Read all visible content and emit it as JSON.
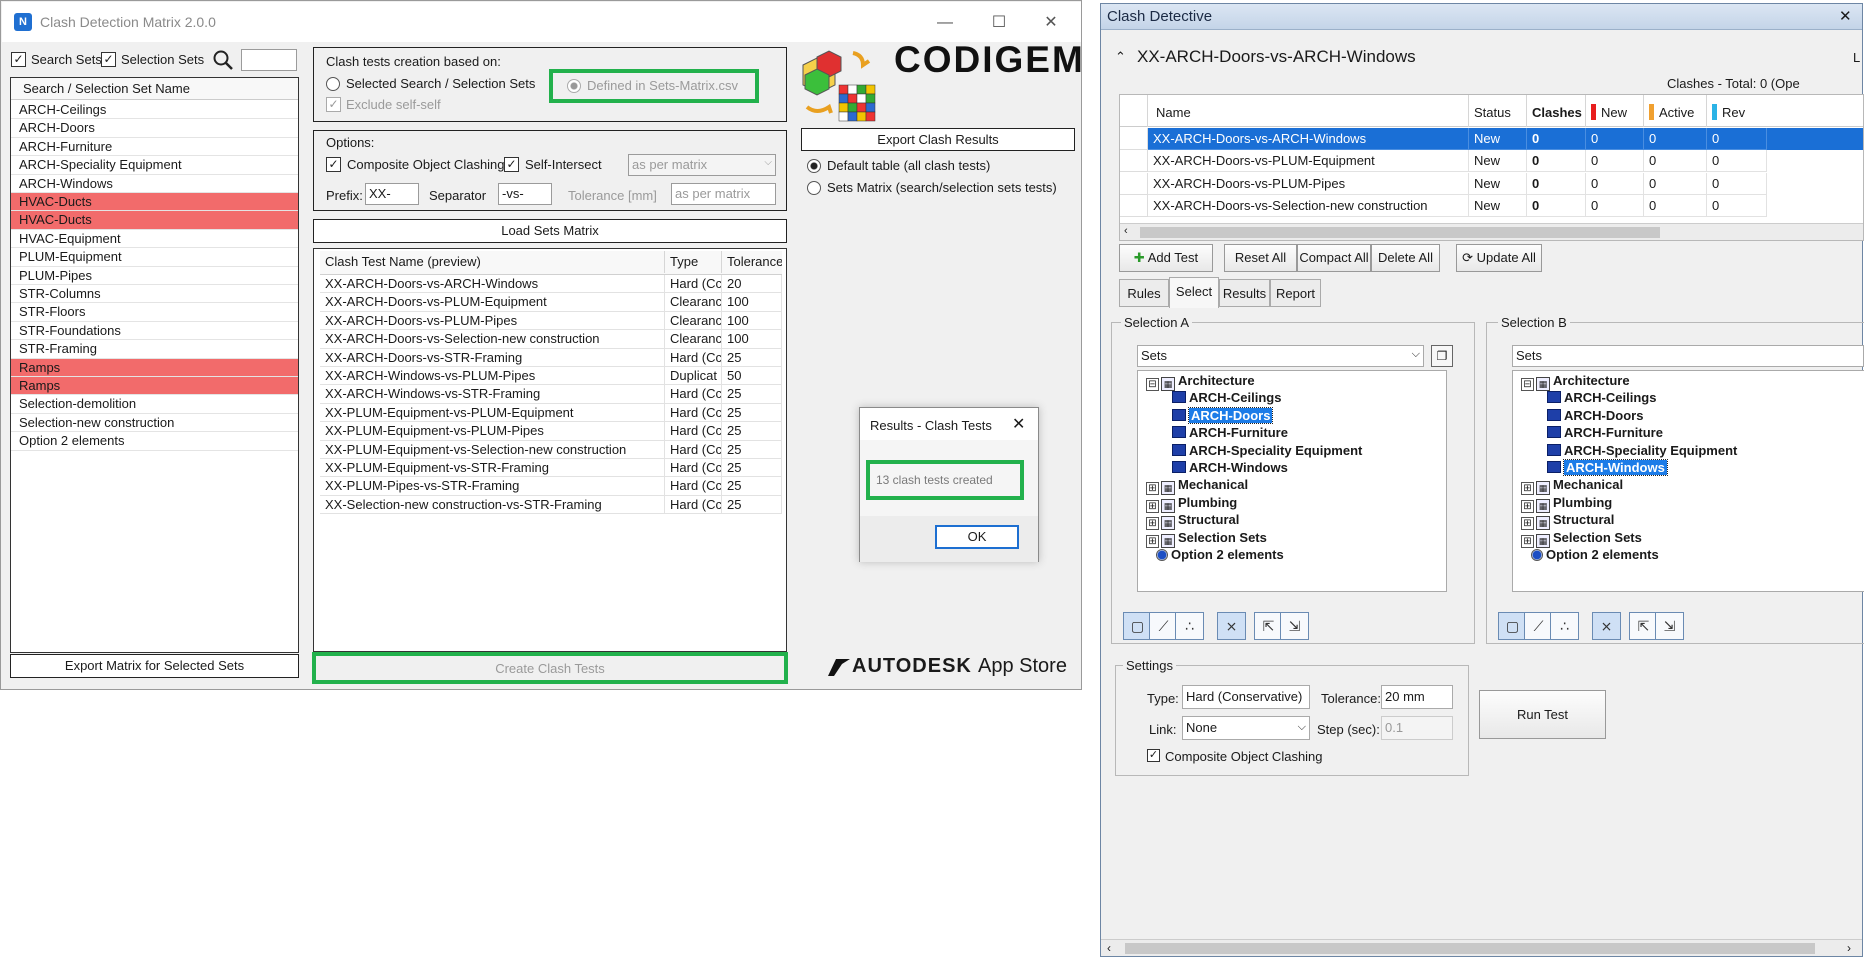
{
  "left_window": {
    "app_icon": "N",
    "title": "Clash Detection Matrix 2.0.0",
    "controls": {
      "minimize": "—",
      "maximize": "☐",
      "close": "✕"
    },
    "filters": {
      "search_sets": "Search Sets",
      "selection_sets": "Selection Sets",
      "search_value": ""
    },
    "list_header": "Search / Selection Set Name",
    "sets": [
      {
        "name": "ARCH-Ceilings",
        "highlight": false
      },
      {
        "name": "ARCH-Doors",
        "highlight": false
      },
      {
        "name": "ARCH-Furniture",
        "highlight": false
      },
      {
        "name": "ARCH-Speciality Equipment",
        "highlight": false
      },
      {
        "name": "ARCH-Windows",
        "highlight": false
      },
      {
        "name": "HVAC-Ducts",
        "highlight": true
      },
      {
        "name": "HVAC-Ducts",
        "highlight": true
      },
      {
        "name": "HVAC-Equipment",
        "highlight": false
      },
      {
        "name": "PLUM-Equipment",
        "highlight": false
      },
      {
        "name": "PLUM-Pipes",
        "highlight": false
      },
      {
        "name": "STR-Columns",
        "highlight": false
      },
      {
        "name": "STR-Floors",
        "highlight": false
      },
      {
        "name": "STR-Foundations",
        "highlight": false
      },
      {
        "name": "STR-Framing",
        "highlight": false
      },
      {
        "name": "Ramps",
        "highlight": true
      },
      {
        "name": "Ramps",
        "highlight": true
      },
      {
        "name": "Selection-demolition",
        "highlight": false
      },
      {
        "name": "Selection-new construction",
        "highlight": false
      },
      {
        "name": "Option 2 elements",
        "highlight": false
      }
    ],
    "export_matrix": "Export Matrix for Selected Sets",
    "creation": {
      "title": "Clash tests creation based on:",
      "opt_selected": "Selected Search / Selection Sets",
      "opt_defined": "Defined in Sets-Matrix.csv",
      "exclude": "Exclude self-self"
    },
    "options": {
      "title": "Options:",
      "composite": "Composite Object Clashing",
      "self_intersect": "Self-Intersect",
      "matrix_select": "as per matrix",
      "prefix_label": "Prefix:",
      "prefix_value": "XX-",
      "separator_label": "Separator",
      "separator_value": "-vs-",
      "tolerance_label": "Tolerance [mm]",
      "tolerance_placeholder": "as per matrix"
    },
    "load_btn": "Load Sets Matrix",
    "preview_headers": [
      "Clash Test Name (preview)",
      "Type",
      "Tolerance"
    ],
    "preview_rows": [
      [
        "XX-ARCH-Doors-vs-ARCH-Windows",
        "Hard (Cc",
        "20"
      ],
      [
        "XX-ARCH-Doors-vs-PLUM-Equipment",
        "Clearanc",
        "100"
      ],
      [
        "XX-ARCH-Doors-vs-PLUM-Pipes",
        "Clearanc",
        "100"
      ],
      [
        "XX-ARCH-Doors-vs-Selection-new construction",
        "Clearanc",
        "100"
      ],
      [
        "XX-ARCH-Doors-vs-STR-Framing",
        "Hard (Cc",
        "25"
      ],
      [
        "XX-ARCH-Windows-vs-PLUM-Pipes",
        "Duplicat",
        "50"
      ],
      [
        "XX-ARCH-Windows-vs-STR-Framing",
        "Hard (Cc",
        "25"
      ],
      [
        "XX-PLUM-Equipment-vs-PLUM-Equipment",
        "Hard (Cc",
        "25"
      ],
      [
        "XX-PLUM-Equipment-vs-PLUM-Pipes",
        "Hard (Cc",
        "25"
      ],
      [
        "XX-PLUM-Equipment-vs-Selection-new construction",
        "Hard (Cc",
        "25"
      ],
      [
        "XX-PLUM-Equipment-vs-STR-Framing",
        "Hard (Cc",
        "25"
      ],
      [
        "XX-PLUM-Pipes-vs-STR-Framing",
        "Hard (Cc",
        "25"
      ],
      [
        "XX-Selection-new construction-vs-STR-Framing",
        "Hard (Cc",
        "25"
      ]
    ],
    "create_btn": "Create Clash Tests",
    "brand": "CODIGEM",
    "export_results": "Export Clash Results",
    "export_default": "Default table (all clash tests)",
    "export_matrix_opt": "Sets Matrix (search/selection sets tests)",
    "dialog": {
      "title": "Results - Clash Tests",
      "message": "13 clash tests created",
      "ok": "OK"
    },
    "autodesk": "AUTODESK",
    "appstore": "App Store"
  },
  "right_window": {
    "title": "Clash Detective",
    "close": "✕",
    "test_name": "XX-ARCH-Doors-vs-ARCH-Windows",
    "right_cut": "L",
    "totals": "Clashes -  Total:  0  (Ope",
    "grid_headers": [
      "Name",
      "Status",
      "Clashes",
      "New",
      "Active",
      "Rev"
    ],
    "grid_header_colors": {
      "new": "#e81e1e",
      "active": "#f0a030",
      "rev": "#2bb3e6"
    },
    "grid_rows": [
      {
        "name": "XX-ARCH-Doors-vs-ARCH-Windows",
        "status": "New",
        "clashes": "0",
        "new": "0",
        "active": "0",
        "rev": "0",
        "selected": true
      },
      {
        "name": "XX-ARCH-Doors-vs-PLUM-Equipment",
        "status": "New",
        "clashes": "0",
        "new": "0",
        "active": "0",
        "rev": "0",
        "selected": false
      },
      {
        "name": "XX-ARCH-Doors-vs-PLUM-Pipes",
        "status": "New",
        "clashes": "0",
        "new": "0",
        "active": "0",
        "rev": "0",
        "selected": false
      },
      {
        "name": "XX-ARCH-Doors-vs-Selection-new construction",
        "status": "New",
        "clashes": "0",
        "new": "0",
        "active": "0",
        "rev": "0",
        "selected": false
      }
    ],
    "buttons": {
      "add_test": "Add Test",
      "reset_all": "Reset All",
      "compact_all": "Compact All",
      "delete_all": "Delete All",
      "update_all": "Update All"
    },
    "tabs": [
      "Rules",
      "Select",
      "Results",
      "Report"
    ],
    "active_tab": "Select",
    "selection_a": {
      "title": "Selection A",
      "dropdown": "Sets"
    },
    "selection_b": {
      "title": "Selection B",
      "dropdown": "Sets"
    },
    "tree_root": "Architecture",
    "tree_children": [
      "ARCH-Ceilings",
      "ARCH-Doors",
      "ARCH-Furniture",
      "ARCH-Speciality Equipment",
      "ARCH-Windows"
    ],
    "tree_groups": [
      "Mechanical",
      "Plumbing",
      "Structural",
      "Selection Sets"
    ],
    "tree_extra": "Option 2 elements",
    "settings": {
      "title": "Settings",
      "type_label": "Type:",
      "type_value": "Hard (Conservative)",
      "tolerance_label": "Tolerance:",
      "tolerance_value": "20 mm",
      "link_label": "Link:",
      "link_value": "None",
      "step_label": "Step (sec):",
      "step_value": "0.1",
      "composite": "Composite Object Clashing"
    },
    "run_test": "Run Test"
  }
}
